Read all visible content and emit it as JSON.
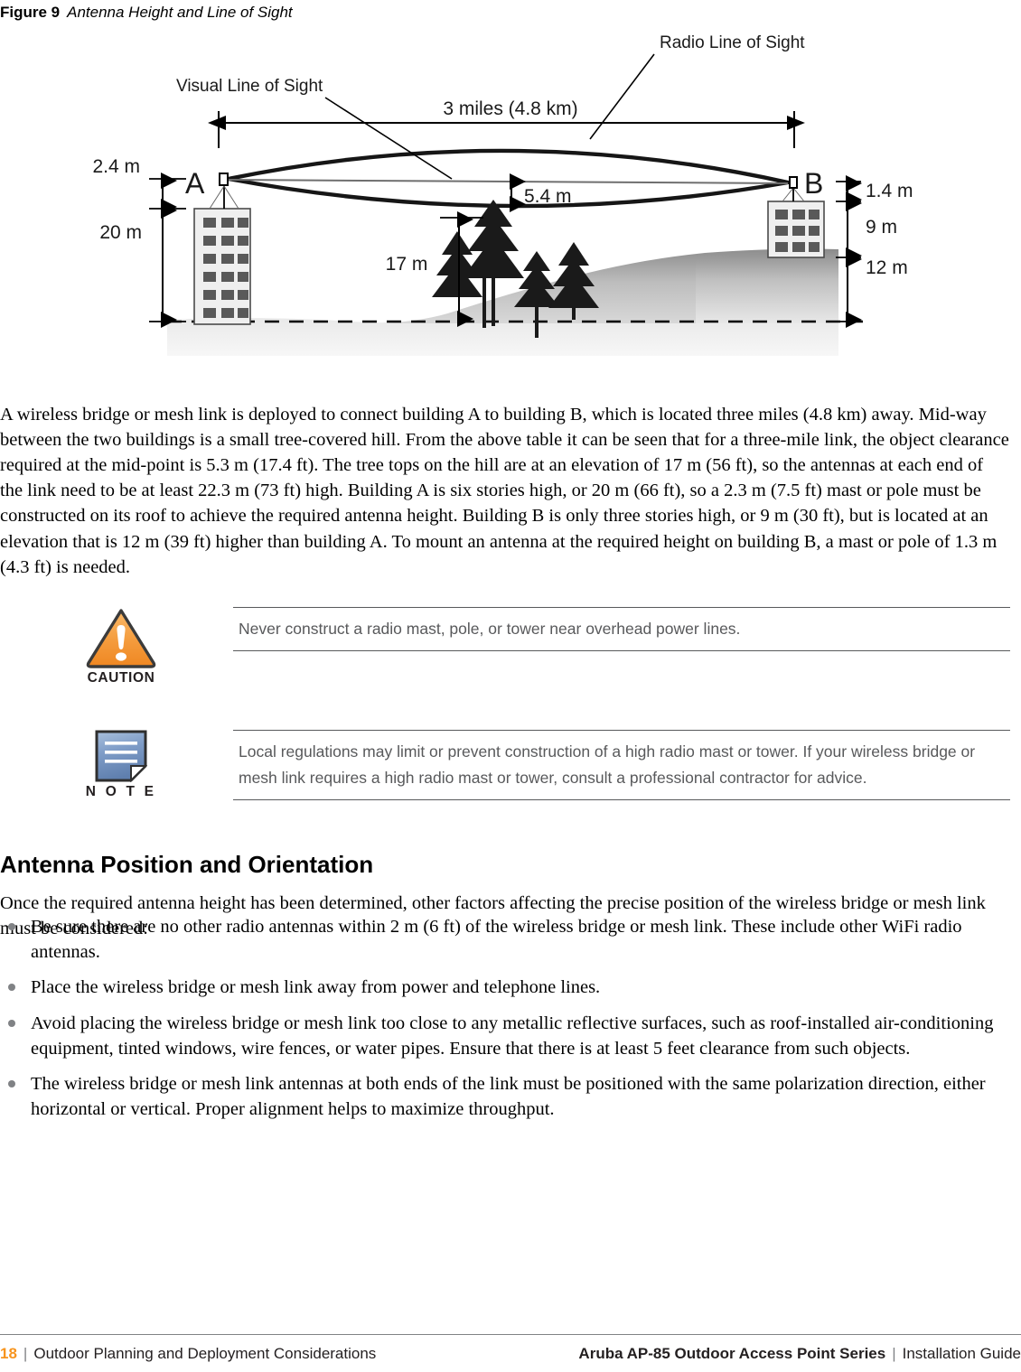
{
  "figure": {
    "label": "Figure 9",
    "title": "Antenna Height and Line of Sight",
    "callouts": {
      "visual_los": "Visual Line of Sight",
      "radio_los": "Radio Line of Sight"
    },
    "dimensions": {
      "span": "3 miles (4.8 km)",
      "clearance": "5.4 m",
      "mast_a": "2.4 m",
      "building_a": "20 m",
      "trees": "17 m",
      "mast_b": "1.4 m",
      "building_b": "9 m",
      "elevation_b": "12 m"
    },
    "buildings": {
      "a_label": "A",
      "b_label": "B",
      "a_floors": 6,
      "a_windows_per_floor": 3,
      "b_floors": 3,
      "b_windows_per_floor": 3
    }
  },
  "paragraphs": {
    "main": "A wireless bridge or mesh link is deployed to connect building A to building B, which is located three miles (4.8 km) away. Mid-way between the two buildings is a small tree-covered hill. From the above table it can be seen that for a three-mile link, the object clearance required at the mid-point is 5.3 m (17.4 ft). The tree tops on the hill are at an elevation of 17 m (56 ft), so the antennas at each end of the link need to be at least 22.3 m (73 ft) high. Building A is six stories high, or 20 m (66 ft), so a 2.3 m (7.5 ft) mast or pole must be constructed on its roof to achieve the required antenna height. Building B is only three stories high, or 9 m (30 ft), but is located at an elevation that is 12 m (39 ft) higher than building A. To mount an antenna at the required height on building B, a mast or pole of 1.3 m (4.3 ft) is needed.",
    "intro": "Once the required antenna height has been determined, other factors affecting the precise position of the wireless bridge or mesh link must be considered:"
  },
  "admonitions": {
    "caution": {
      "word": "CAUTION",
      "icon": "warning-triangle-icon",
      "text": "Never construct a radio mast, pole, or tower near overhead power lines."
    },
    "note": {
      "word": "N O T E",
      "icon": "note-document-icon",
      "text": "Local regulations may limit or prevent construction of a high radio mast or tower. If your wireless bridge or mesh link requires a high radio mast or tower, consult a professional contractor for advice."
    }
  },
  "section": {
    "heading": "Antenna Position and Orientation"
  },
  "bullets": [
    "Be sure there are no other radio antennas within 2 m (6 ft) of the wireless bridge or mesh link. These include other WiFi radio antennas.",
    "Place the wireless bridge or mesh link away from power and telephone lines.",
    "Avoid placing the wireless bridge or mesh link too close to any metallic reflective surfaces, such as roof-installed air-conditioning equipment, tinted windows, wire fences, or water pipes. Ensure that there is at least 5 feet clearance from such objects.",
    "The wireless bridge or mesh link antennas at both ends of the link must be positioned with the same polarization direction, either horizontal or vertical. Proper alignment helps to maximize throughput."
  ],
  "footer": {
    "page_number": "18",
    "separator": "|",
    "chapter": "Outdoor Planning and Deployment Considerations",
    "product": "Aruba AP-85 Outdoor Access Point Series",
    "guide": "Installation Guide"
  },
  "colors": {
    "accent_orange": "#f7941e",
    "caution_orange": "#f5a144",
    "note_blue": "#6c8cc0",
    "rule_gray": "#808285",
    "admon_text": "#58595b"
  }
}
